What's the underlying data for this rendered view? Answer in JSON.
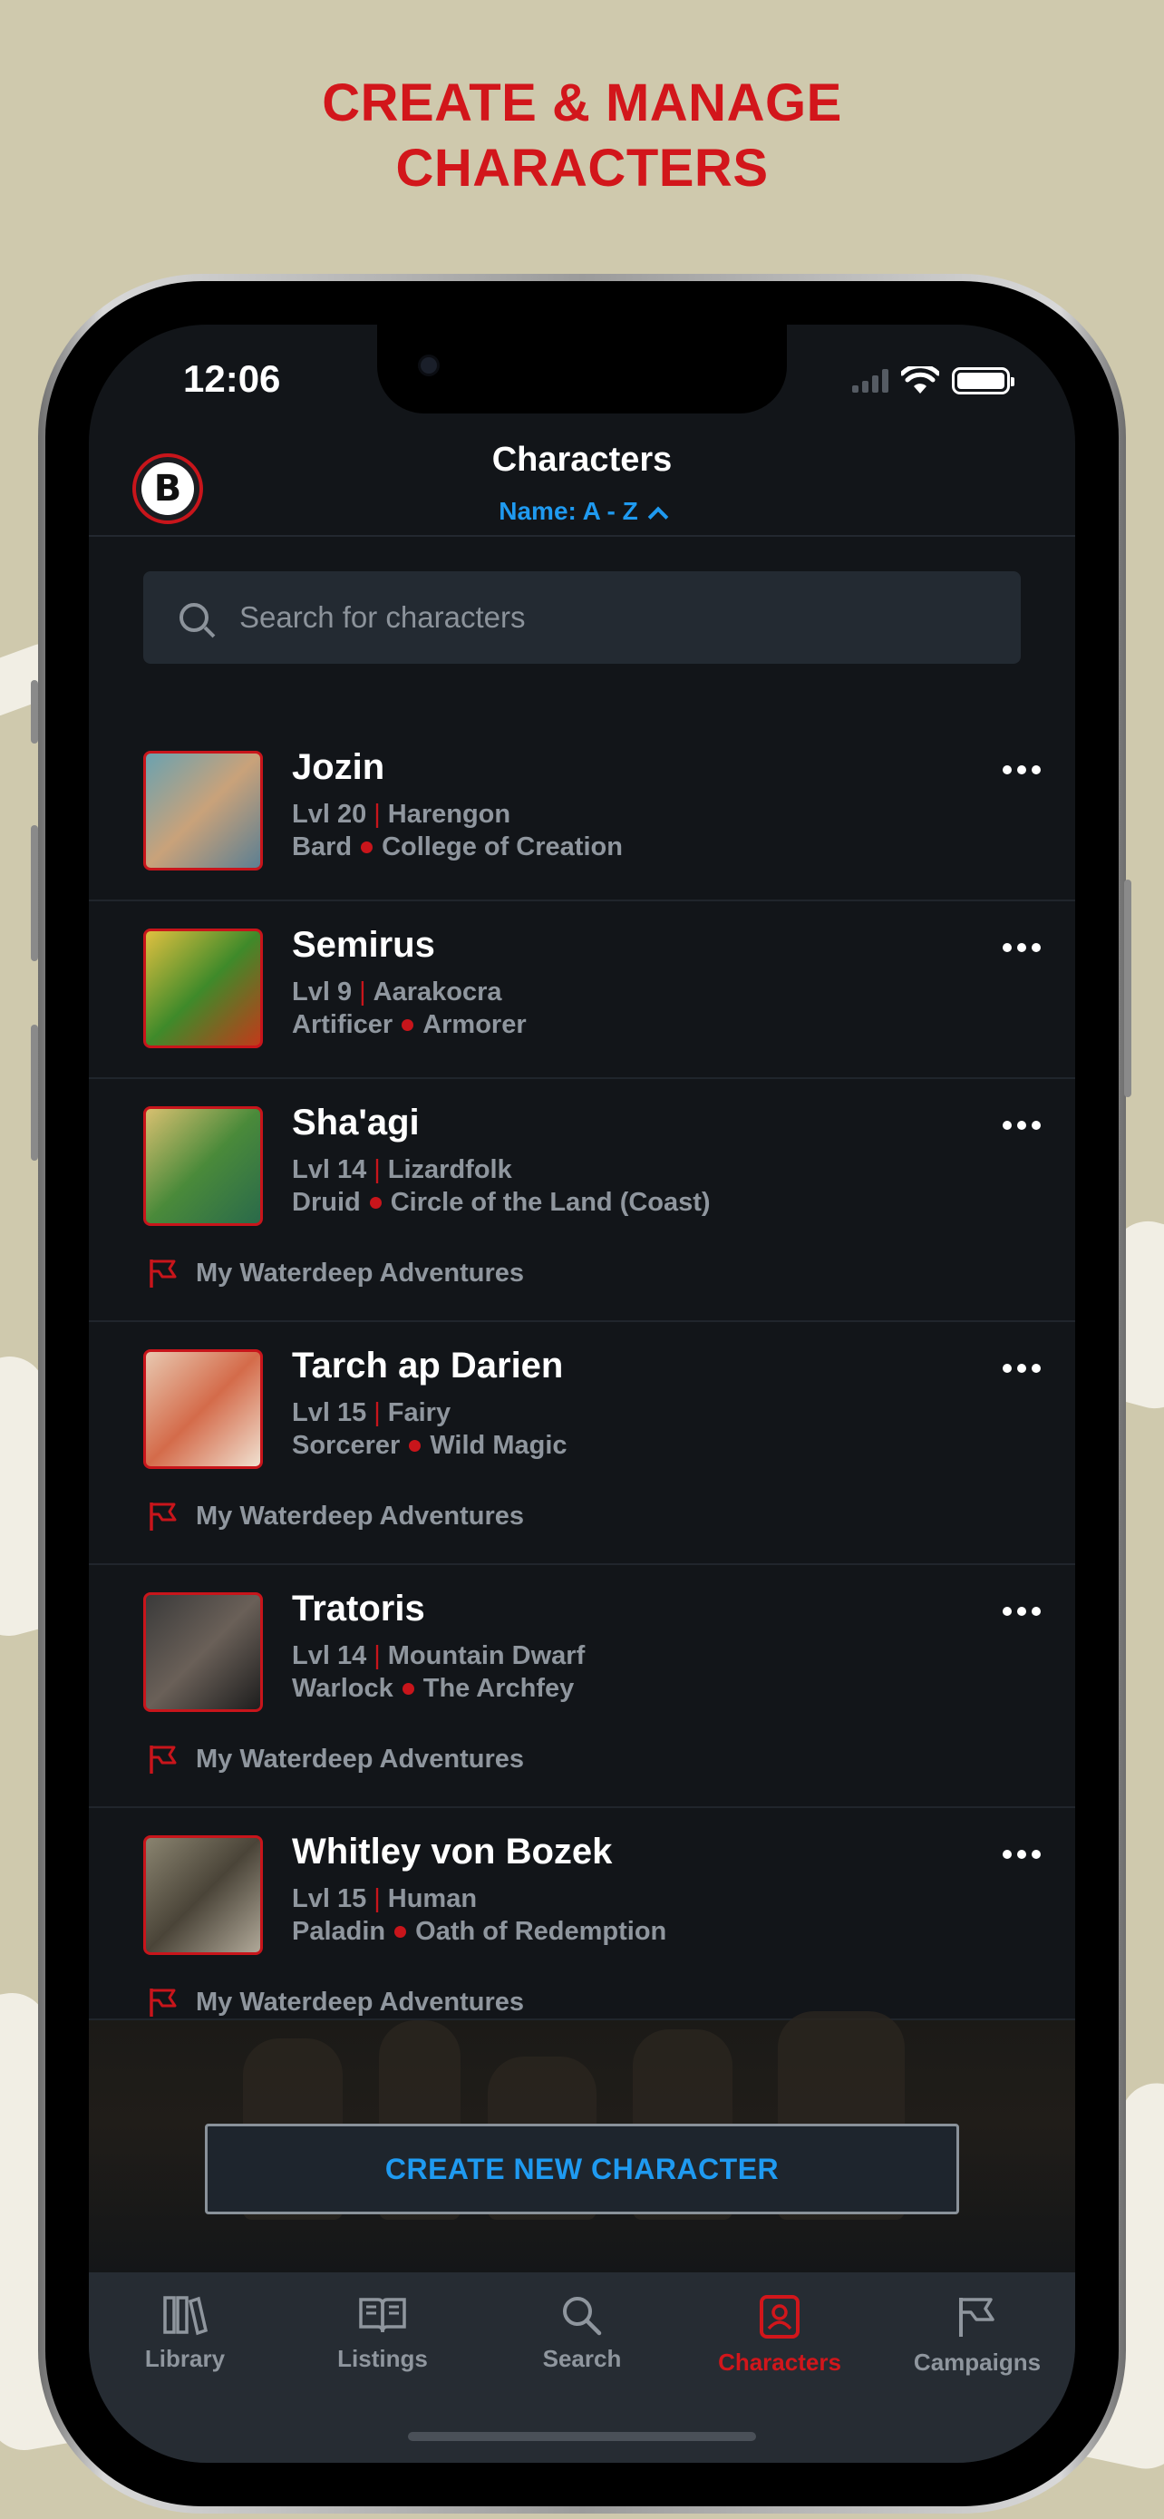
{
  "promo": {
    "line1": "CREATE & MANAGE",
    "line2": "CHARACTERS"
  },
  "status": {
    "time": "12:06"
  },
  "header": {
    "logo_letter": "B",
    "title": "Characters",
    "sort_label": "Name: A - Z"
  },
  "search": {
    "placeholder": "Search for characters"
  },
  "characters": [
    {
      "name": "Jozin",
      "level": "Lvl 20",
      "race": "Harengon",
      "class": "Bard",
      "subclass": "College of Creation",
      "campaign": ""
    },
    {
      "name": "Semirus",
      "level": "Lvl 9",
      "race": "Aarakocra",
      "class": "Artificer",
      "subclass": "Armorer",
      "campaign": ""
    },
    {
      "name": "Sha'agi",
      "level": "Lvl 14",
      "race": "Lizardfolk",
      "class": "Druid",
      "subclass": "Circle of the Land (Coast)",
      "campaign": "My Waterdeep Adventures"
    },
    {
      "name": "Tarch ap Darien",
      "level": "Lvl 15",
      "race": "Fairy",
      "class": "Sorcerer",
      "subclass": "Wild Magic",
      "campaign": "My Waterdeep Adventures"
    },
    {
      "name": "Tratoris",
      "level": "Lvl 14",
      "race": "Mountain Dwarf",
      "class": "Warlock",
      "subclass": "The Archfey",
      "campaign": "My Waterdeep Adventures"
    },
    {
      "name": "Whitley von Bozek",
      "level": "Lvl 15",
      "race": "Human",
      "class": "Paladin",
      "subclass": "Oath of Redemption",
      "campaign": "My Waterdeep Adventures"
    }
  ],
  "create_button": "CREATE NEW CHARACTER",
  "tabs": [
    {
      "label": "Library",
      "icon": "library-icon"
    },
    {
      "label": "Listings",
      "icon": "book-icon"
    },
    {
      "label": "Search",
      "icon": "search-icon"
    },
    {
      "label": "Characters",
      "icon": "character-sheet-icon",
      "active": true
    },
    {
      "label": "Campaigns",
      "icon": "flag-icon"
    }
  ],
  "colors": {
    "accent_red": "#d2161b",
    "accent_blue": "#1f9af0",
    "screen_bg": "#121519"
  }
}
